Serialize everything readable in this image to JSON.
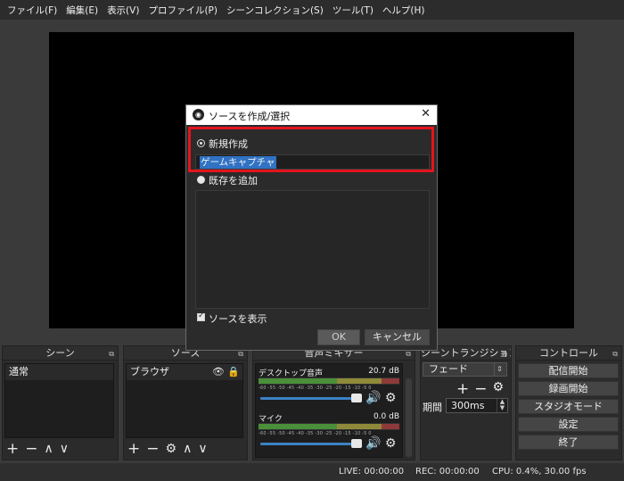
{
  "menubar": {
    "items": [
      "ファイル(F)",
      "編集(E)",
      "表示(V)",
      "プロファイル(P)",
      "シーンコレクション(S)",
      "ツール(T)",
      "ヘルプ(H)"
    ]
  },
  "docks": {
    "scenes": {
      "title": "シーン",
      "items": [
        "通常"
      ]
    },
    "sources": {
      "title": "ソース",
      "items": [
        "ブラウザ"
      ]
    },
    "mixer": {
      "title": "音声ミキサー",
      "tracks": [
        {
          "name": "デスクトップ音声",
          "db": "20.7 dB",
          "level": 0.55
        },
        {
          "name": "マイク",
          "db": "0.0 dB",
          "level": 0.0
        }
      ],
      "ticks": "-60 -55 -50 -45 -40 -35 -30 -25 -20 -15 -10 -5 0"
    },
    "transitions": {
      "title": "シーントランジション",
      "selected": "フェード",
      "duration_label": "期間",
      "duration_value": "300ms"
    },
    "controls": {
      "title": "コントロール",
      "buttons": [
        "配信開始",
        "録画開始",
        "スタジオモード",
        "設定",
        "終了"
      ]
    }
  },
  "statusbar": {
    "live": "LIVE: 00:00:00",
    "rec": "REC: 00:00:00",
    "cpu": "CPU: 0.4%, 30.00 fps"
  },
  "dialog": {
    "title": "ソースを作成/選択",
    "create_new_label": "新規作成",
    "name_value": "ゲームキャプチャ",
    "add_existing_label": "既存を追加",
    "show_source_label": "ソースを表示",
    "ok_label": "OK",
    "cancel_label": "キャンセル"
  },
  "colors": {
    "highlight": "#e3141e",
    "selection": "#3072c4",
    "background": "#3a3a3a"
  }
}
